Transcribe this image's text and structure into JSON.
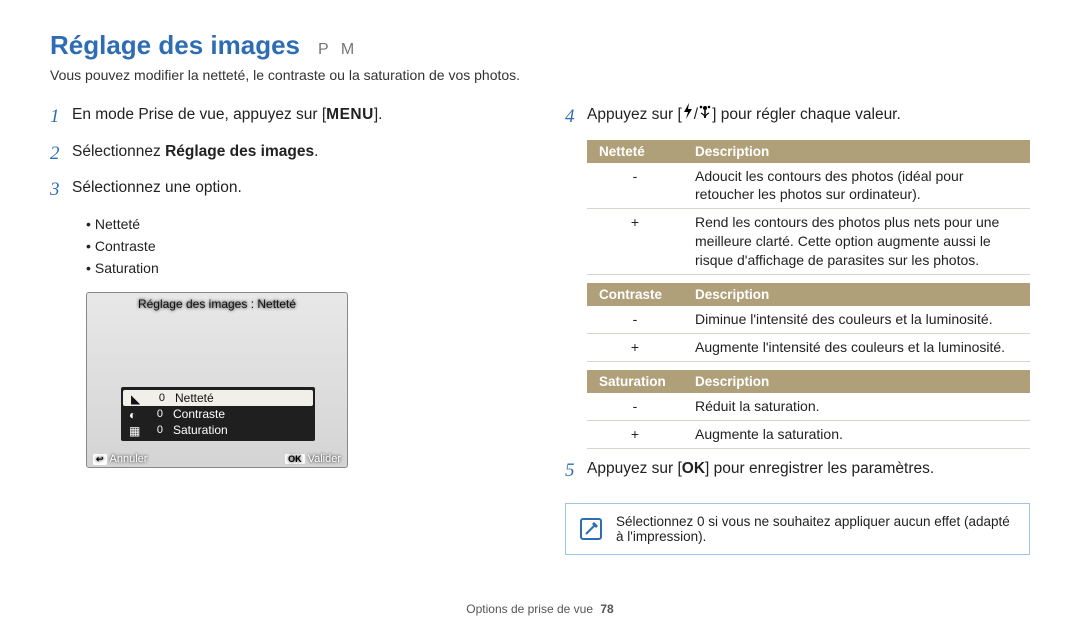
{
  "header": {
    "title": "Réglage des images",
    "modes": "P M",
    "subtitle": "Vous pouvez modifier la netteté, le contraste ou la saturation de vos photos."
  },
  "left": {
    "step1_a": "En mode Prise de vue, appuyez sur [",
    "step1_key": "MENU",
    "step1_b": "].",
    "step2_a": "Sélectionnez ",
    "step2_bold": "Réglage des images",
    "step2_b": ".",
    "step3": "Sélectionnez une option.",
    "options": [
      "Netteté",
      "Contraste",
      "Saturation"
    ],
    "lcd": {
      "top": "Réglage des images : Netteté",
      "rows": [
        {
          "label": "Netteté",
          "val": "0",
          "selected": true
        },
        {
          "label": "Contraste",
          "val": "0",
          "selected": false
        },
        {
          "label": "Saturation",
          "val": "0",
          "selected": false
        }
      ],
      "cancel": "Annuler",
      "ok": "Valider",
      "back_key": "↩",
      "ok_key": "OK"
    }
  },
  "right": {
    "step4_a": "Appuyez sur [",
    "step4_b": "] pour régler chaque valeur.",
    "tables": [
      {
        "header1": "Netteté",
        "rows": [
          {
            "sym": "-",
            "desc": "Adoucit les contours des photos (idéal pour retoucher les photos sur ordinateur)."
          },
          {
            "sym": "+",
            "desc": "Rend les contours des photos plus nets pour une meilleure clarté. Cette option augmente aussi le risque d'affichage de parasites sur les photos."
          }
        ]
      },
      {
        "header1": "Contraste",
        "rows": [
          {
            "sym": "-",
            "desc": "Diminue l'intensité des couleurs et la luminosité."
          },
          {
            "sym": "+",
            "desc": "Augmente l'intensité des couleurs et la luminosité."
          }
        ]
      },
      {
        "header1": "Saturation",
        "rows": [
          {
            "sym": "-",
            "desc": "Réduit la saturation."
          },
          {
            "sym": "+",
            "desc": "Augmente la saturation."
          }
        ]
      }
    ],
    "desc_header": "Description",
    "step5_a": "Appuyez sur [",
    "step5_key": "OK",
    "step5_b": "] pour enregistrer les paramètres.",
    "note": "Sélectionnez 0 si vous ne souhaitez appliquer aucun effet (adapté à l'impression)."
  },
  "footer": {
    "section": "Options de prise de vue",
    "page": "78"
  }
}
